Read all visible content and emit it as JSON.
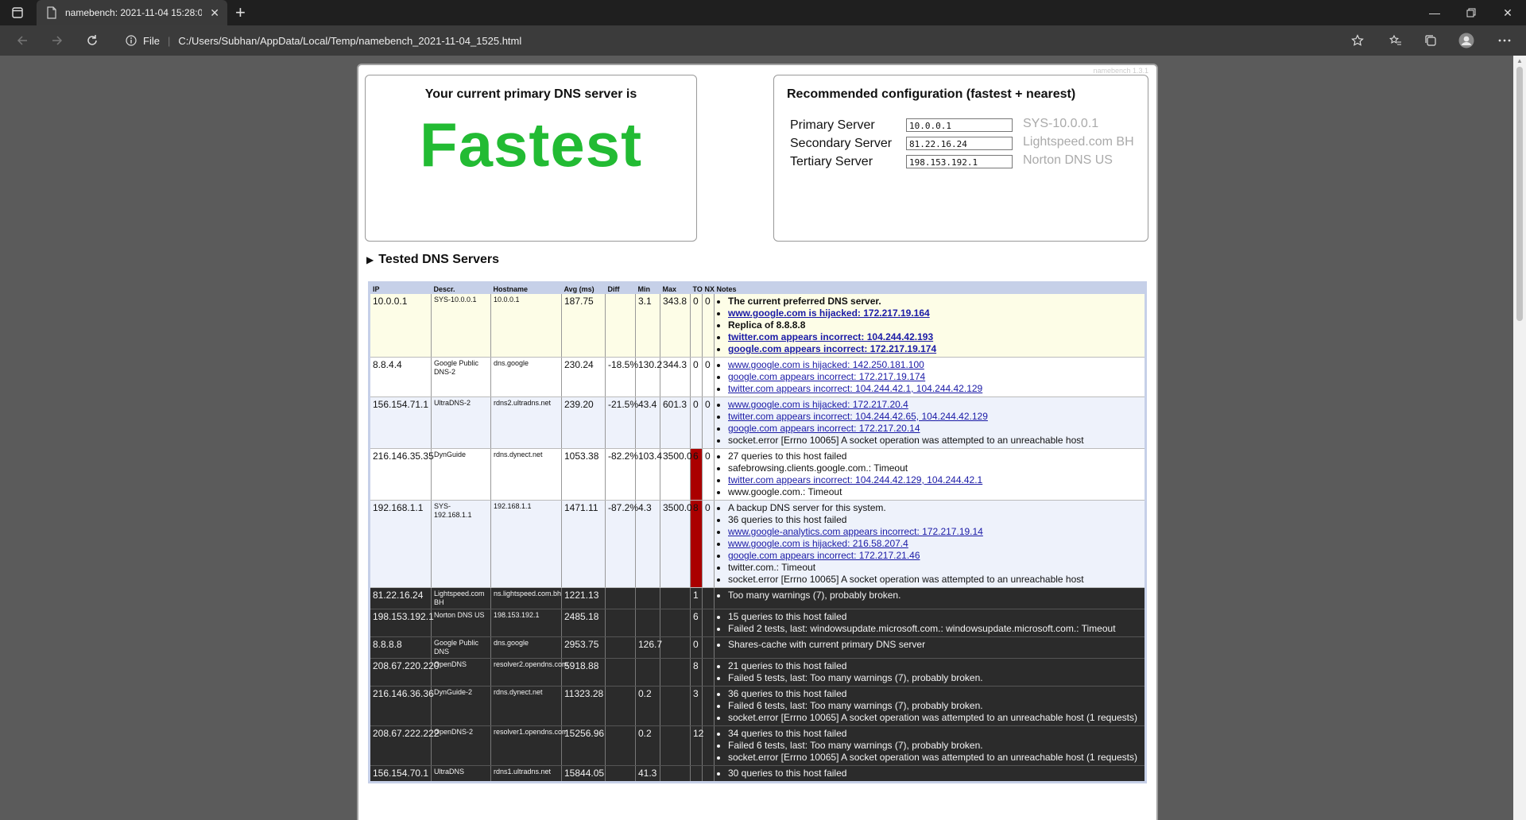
{
  "browser": {
    "tab_title": "namebench: 2021-11-04 15:28:0",
    "protocol": "File",
    "url": "C:/Users/Subhan/AppData/Local/Temp/namebench_2021-11-04_1525.html"
  },
  "page": {
    "version": "namebench 1.3.1",
    "current_label": "Your current primary DNS server is",
    "current_verdict": "Fastest",
    "recommended_label": "Recommended configuration (fastest + nearest)",
    "config": [
      {
        "name": "Primary Server",
        "ip": "10.0.0.1",
        "desc": "SYS-10.0.0.1"
      },
      {
        "name": "Secondary Server",
        "ip": "81.22.16.24",
        "desc": "Lightspeed.com BH"
      },
      {
        "name": "Tertiary Server",
        "ip": "198.153.192.1",
        "desc": "Norton DNS US"
      }
    ],
    "tested_heading": "Tested DNS Servers"
  },
  "table": {
    "headers": [
      "IP",
      "Descr.",
      "Hostname",
      "Avg (ms)",
      "Diff",
      "Min",
      "Max",
      "TO",
      "NX",
      "Notes"
    ],
    "rows": [
      {
        "ip": "10.0.0.1",
        "descr": "SYS-10.0.0.1",
        "host": "10.0.0.1",
        "avg": "187.75",
        "diff": "",
        "min": "3.1",
        "max": "343.8",
        "to": "0",
        "nx": "0",
        "notes": [
          {
            "text": "The current preferred DNS server.",
            "link": false
          },
          {
            "text": "www.google.com is hijacked: 172.217.19.164",
            "link": true
          },
          {
            "text": "Replica of 8.8.8.8",
            "link": false
          },
          {
            "text": "twitter.com appears incorrect: 104.244.42.193",
            "link": true
          },
          {
            "text": "google.com appears incorrect: 172.217.19.174",
            "link": true
          }
        ]
      },
      {
        "ip": "8.8.4.4",
        "descr": "Google Public DNS-2",
        "host": "dns.google",
        "avg": "230.24",
        "diff": "-18.5%",
        "min": "130.2",
        "max": "344.3",
        "to": "0",
        "nx": "0",
        "notes": [
          {
            "text": "www.google.com is hijacked: 142.250.181.100",
            "link": true
          },
          {
            "text": "google.com appears incorrect: 172.217.19.174",
            "link": true
          },
          {
            "text": "twitter.com appears incorrect: 104.244.42.1, 104.244.42.129",
            "link": true
          }
        ]
      },
      {
        "ip": "156.154.71.1",
        "descr": "UltraDNS-2",
        "host": "rdns2.ultradns.net",
        "avg": "239.20",
        "diff": "-21.5%",
        "min": "43.4",
        "max": "601.3",
        "to": "0",
        "nx": "0",
        "notes": [
          {
            "text": "www.google.com is hijacked: 172.217.20.4",
            "link": true
          },
          {
            "text": "twitter.com appears incorrect: 104.244.42.65, 104.244.42.129",
            "link": true
          },
          {
            "text": "google.com appears incorrect: 172.217.20.14",
            "link": true
          },
          {
            "text": "socket.error [Errno 10065] A socket operation was attempted to an unreachable host",
            "link": false
          }
        ]
      },
      {
        "ip": "216.146.35.35",
        "descr": "DynGuide",
        "host": "rdns.dynect.net",
        "avg": "1053.38",
        "diff": "-82.2%",
        "min": "103.4",
        "max": "3500.0",
        "to": "6",
        "nx": "0",
        "notes": [
          {
            "text": "27 queries to this host failed",
            "link": false
          },
          {
            "text": "safebrowsing.clients.google.com.: Timeout",
            "link": false
          },
          {
            "text": "twitter.com appears incorrect: 104.244.42.129, 104.244.42.1",
            "link": true
          },
          {
            "text": "www.google.com.: Timeout",
            "link": false
          }
        ]
      },
      {
        "ip": "192.168.1.1",
        "descr": "SYS-192.168.1.1",
        "host": "192.168.1.1",
        "avg": "1471.11",
        "diff": "-87.2%",
        "min": "4.3",
        "max": "3500.0",
        "to": "8",
        "nx": "0",
        "notes": [
          {
            "text": "A backup DNS server for this system.",
            "link": false
          },
          {
            "text": "36 queries to this host failed",
            "link": false
          },
          {
            "text": "www.google-analytics.com appears incorrect: 172.217.19.14",
            "link": true
          },
          {
            "text": "www.google.com is hijacked: 216.58.207.4",
            "link": true
          },
          {
            "text": "google.com appears incorrect: 172.217.21.46",
            "link": true
          },
          {
            "text": "twitter.com.: Timeout",
            "link": false
          },
          {
            "text": "socket.error [Errno 10065] A socket operation was attempted to an unreachable host",
            "link": false
          }
        ]
      },
      {
        "ip": "81.22.16.24",
        "descr": "Lightspeed.com BH",
        "host": "ns.lightspeed.com.bh",
        "avg": "1221.13",
        "diff": "",
        "min": "",
        "max": "",
        "to": "1",
        "nx": "",
        "notes": [
          {
            "text": "Too many warnings (7), probably broken.",
            "link": false
          }
        ]
      },
      {
        "ip": "198.153.192.1",
        "descr": "Norton DNS US",
        "host": "198.153.192.1",
        "avg": "2485.18",
        "diff": "",
        "min": "",
        "max": "",
        "to": "6",
        "nx": "",
        "notes": [
          {
            "text": "15 queries to this host failed",
            "link": false
          },
          {
            "text": "Failed 2 tests, last: windowsupdate.microsoft.com.: windowsupdate.microsoft.com.: Timeout",
            "link": false
          }
        ]
      },
      {
        "ip": "8.8.8.8",
        "descr": "Google Public DNS",
        "host": "dns.google",
        "avg": "2953.75",
        "diff": "",
        "min": "126.7",
        "max": "",
        "to": "0",
        "nx": "",
        "notes": [
          {
            "text": "Shares-cache with current primary DNS server",
            "link": false
          }
        ]
      },
      {
        "ip": "208.67.220.220",
        "descr": "OpenDNS",
        "host": "resolver2.opendns.com",
        "avg": "5918.88",
        "diff": "",
        "min": "",
        "max": "",
        "to": "8",
        "nx": "",
        "notes": [
          {
            "text": "21 queries to this host failed",
            "link": false
          },
          {
            "text": "Failed 5 tests, last: Too many warnings (7), probably broken.",
            "link": false
          }
        ]
      },
      {
        "ip": "216.146.36.36",
        "descr": "DynGuide-2",
        "host": "rdns.dynect.net",
        "avg": "11323.28",
        "diff": "",
        "min": "0.2",
        "max": "",
        "to": "3",
        "nx": "",
        "notes": [
          {
            "text": "36 queries to this host failed",
            "link": false
          },
          {
            "text": "Failed 6 tests, last: Too many warnings (7), probably broken.",
            "link": false
          },
          {
            "text": "socket.error [Errno 10065] A socket operation was attempted to an unreachable host (1 requests)",
            "link": false
          }
        ]
      },
      {
        "ip": "208.67.222.222",
        "descr": "OpenDNS-2",
        "host": "resolver1.opendns.com",
        "avg": "15256.96",
        "diff": "",
        "min": "0.2",
        "max": "",
        "to": "12",
        "nx": "",
        "notes": [
          {
            "text": "34 queries to this host failed",
            "link": false
          },
          {
            "text": "Failed 6 tests, last: Too many warnings (7), probably broken.",
            "link": false
          },
          {
            "text": "socket.error [Errno 10065] A socket operation was attempted to an unreachable host (1 requests)",
            "link": false
          }
        ]
      },
      {
        "ip": "156.154.70.1",
        "descr": "UltraDNS",
        "host": "rdns1.ultradns.net",
        "avg": "15844.05",
        "diff": "",
        "min": "41.3",
        "max": "",
        "to": "",
        "nx": "",
        "notes": [
          {
            "text": "30 queries to this host failed",
            "link": false
          }
        ]
      }
    ]
  },
  "colors": {
    "verdict": "#22bb33",
    "timeout_cell": "#aa0000",
    "broken_row": "#2b2b2b",
    "link": "#1a1aa6"
  }
}
